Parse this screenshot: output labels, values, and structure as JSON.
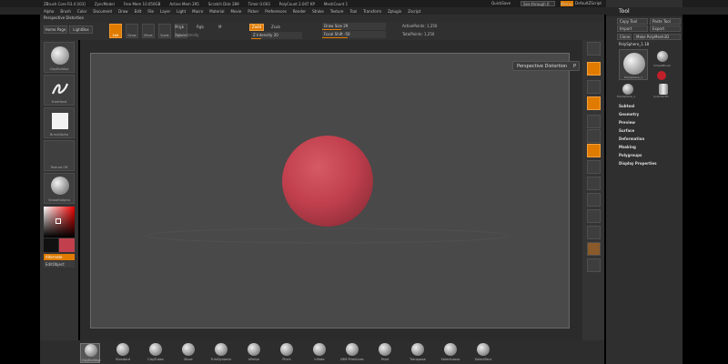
{
  "topbar": {
    "title": "ZBrush Core R3.4 [i03]",
    "doc": "ZyncModel",
    "free_mem": "Free Mem 10.050GB",
    "active_mem": "Active Mem 295",
    "scratch": "Scratch Disk 289",
    "timers": "Timer 0.003",
    "polycount": "PolyCount 2.047 KP",
    "meshcount": "MeshCount 1",
    "quicksave": "QuickSave",
    "see_through": "See-through 0",
    "menus": "Menus",
    "default_script": "DefaultZScript"
  },
  "menubar": [
    "Alpha",
    "Brush",
    "Color",
    "Document",
    "Draw",
    "Edit",
    "File",
    "Layer",
    "Light",
    "Macro",
    "Material",
    "Movie",
    "Picker",
    "Preferences",
    "Render",
    "Stroke",
    "Texture",
    "Tool",
    "Transform",
    "Zplugin",
    "Zscript"
  ],
  "palette_label": "Perspective Distortion",
  "shelf": {
    "home_page": "Home Page",
    "lightbox": "LightBox",
    "tools": [
      "Edit",
      "Draw",
      "Move",
      "Scale",
      "Rotate"
    ],
    "mrgb": "Mrgb",
    "rgb": "Rgb",
    "m": "M",
    "rgb_intensity": "Rgb Intensity",
    "zadd": "Zadd",
    "zsub": "Zsub",
    "z_intensity": "Z Intensity 20",
    "draw_size": "Draw Size 29",
    "focal_shift": "Focal Shift -50",
    "active_points": "ActivePoints: 1,250",
    "total_points": "TotalPoints: 1,250"
  },
  "leftshelf": {
    "items": [
      "ClayBuildup",
      "FreeHand",
      "BrushAlpha",
      "Texture Off",
      "SmoothAlpha"
    ],
    "alternate": "Alternate",
    "editobject": "EditObject"
  },
  "tooltip": "Perspective Distortion",
  "toolpanel": {
    "title": "Tool",
    "copy_tool": "Copy Tool",
    "paste_tool": "Paste Tool",
    "import": "Import",
    "export": "Export",
    "clone": "Clone",
    "make_polymesh": "Make PolyMesh3D",
    "current": "PolySphere_1.18",
    "thumbs": [
      "PolySphere_1",
      "SimpleBrush",
      "PolySphere_1",
      "Cylinder3D"
    ],
    "sections": [
      "Subtool",
      "Geometry",
      "Preview",
      "Surface",
      "Deformation",
      "Masking",
      "Polygroups",
      "Display Properties"
    ]
  },
  "bottom_brushes": [
    "ClayBuildup",
    "Standard",
    "ClayTubes",
    "Move",
    "TrimDynamic",
    "hPolish",
    "Pinch",
    "Inflate",
    "IMM Primitives",
    "Paint",
    "Transpose",
    "SelectLasso",
    "SelectRect"
  ],
  "colors": {
    "accent": "#e07b00",
    "sphere": "#c2404e",
    "canvas": "#494949"
  }
}
